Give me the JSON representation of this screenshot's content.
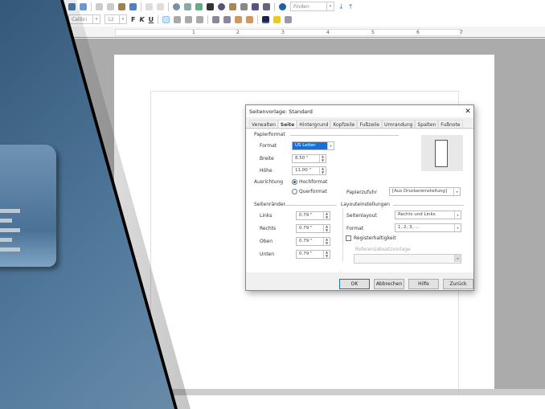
{
  "toolbar": {
    "find_placeholder": "Finden",
    "font_name": "Calibri",
    "font_size": "12",
    "bold": "F",
    "italic": "K",
    "underline": "U"
  },
  "ruler": {
    "numbers": [
      "1",
      "2",
      "3",
      "4",
      "5",
      "6",
      "7"
    ]
  },
  "dialog": {
    "title": "Seitenvorlage: Standard",
    "close": "✕",
    "tabs": [
      "Verwalten",
      "Seite",
      "Hintergrund",
      "Kopfzeile",
      "Fußzeile",
      "Umrandung",
      "Spalten",
      "Fußnote"
    ],
    "active_tab": "Seite",
    "paper": {
      "heading": "Papierformat",
      "format_label": "Format",
      "format_value": "US Letter",
      "width_label": "Breite",
      "width_value": "8.50 \"",
      "height_label": "Höhe",
      "height_value": "11.00 \"",
      "orientation_label": "Ausrichtung",
      "portrait": "Hochformat",
      "landscape": "Querformat",
      "tray_label": "Papierzufuhr",
      "tray_value": "[Aus Druckereinstellung]"
    },
    "margins": {
      "heading": "Seitenränder",
      "items": [
        {
          "label": "Links",
          "value": "0.79 \""
        },
        {
          "label": "Rechts",
          "value": "0.79 \""
        },
        {
          "label": "Oben",
          "value": "0.79 \""
        },
        {
          "label": "Unten",
          "value": "0.79 \""
        }
      ]
    },
    "layout": {
      "heading": "Layouteinstellungen",
      "page_layout_label": "Seitenlayout",
      "page_layout_value": "Rechts und Links",
      "format_label": "Format",
      "format_value": "1, 2, 3, ...",
      "register_label": "Registerhaltigkeit",
      "ref_style_label": "Referenzabsatzvorlage"
    },
    "buttons": {
      "ok": "OK",
      "cancel": "Abbrechen",
      "help": "Hilfe",
      "reset": "Zurück"
    }
  }
}
